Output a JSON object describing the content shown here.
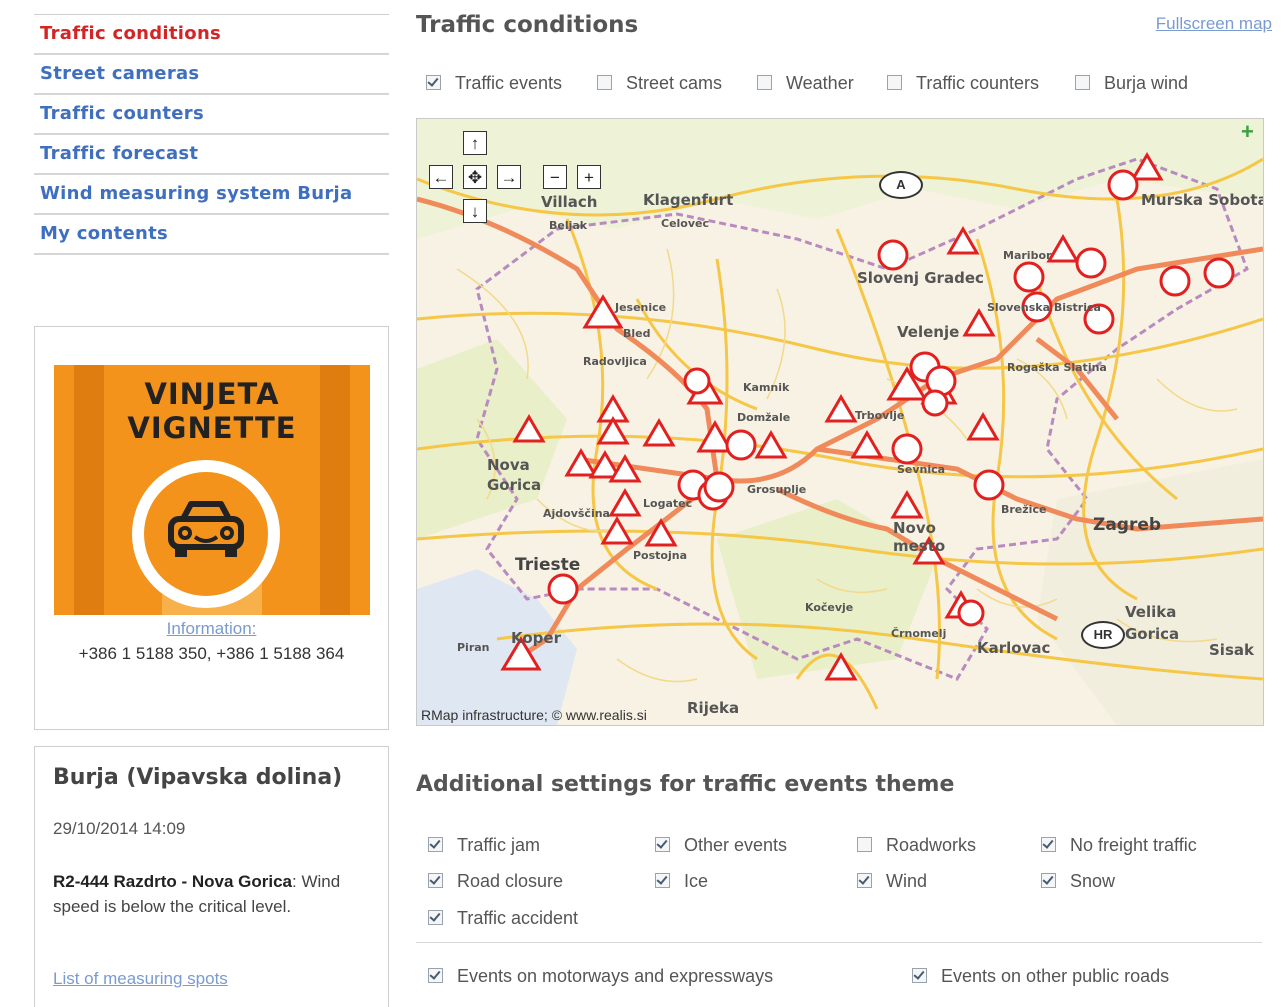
{
  "nav": {
    "items": [
      {
        "label": "Traffic conditions",
        "active": true
      },
      {
        "label": "Street cameras"
      },
      {
        "label": "Traffic counters"
      },
      {
        "label": "Traffic forecast"
      },
      {
        "label": "Wind measuring system Burja"
      },
      {
        "label": "My contents"
      }
    ]
  },
  "vignette": {
    "title_line1": "VINJETA",
    "title_line2": "VIGNETTE",
    "info_link": "Information:",
    "phones": "+386 1 5188 350, +386 1 5188 364"
  },
  "burja": {
    "title": "Burja (Vipavska dolina)",
    "date": "29/10/2014 14:09",
    "road": "R2-444 Razdrto - Nova Gorica",
    "message": ": Wind speed is below the critical level.",
    "link": "List of measuring spots"
  },
  "main": {
    "title": "Traffic conditions",
    "fullscreen_link": "Fullscreen map",
    "layers": [
      {
        "label": "Traffic events",
        "checked": true
      },
      {
        "label": "Street cams",
        "checked": false
      },
      {
        "label": "Weather",
        "checked": false
      },
      {
        "label": "Traffic counters",
        "checked": false
      },
      {
        "label": "Burja wind",
        "checked": false
      }
    ]
  },
  "map": {
    "copyright": "RMap infrastructure; © www.realis.si",
    "cities": [
      "Villach",
      "Beljak",
      "Klagenfurt",
      "Celovec",
      "Slovenj Gradec",
      "Maribor",
      "Murska Sobota",
      "Slovenska Bistrica",
      "Velenje",
      "Rogaška Slatina",
      "Kamnik",
      "Domžale",
      "Trbovlje",
      "Bled",
      "Radovljica",
      "Jesenice",
      "Nova Gorica",
      "Ajdovščina",
      "Logatec",
      "Grosuplje",
      "Sevnica",
      "Brežice",
      "Zagreb",
      "Novo mesto",
      "Trieste",
      "Koper",
      "Piran",
      "Postojna",
      "Kočevje",
      "Črnomelj",
      "Karlovac",
      "Velika Gorica",
      "Sisak",
      "Rijeka"
    ],
    "country_badges": [
      "A",
      "HR"
    ],
    "colors": {
      "motorway": "#f08a5a",
      "main_road": "#f6c646",
      "land": "#f7f2e3",
      "forest": "#e8efc9",
      "border": "#b88ac0",
      "event_red": "#e32020"
    }
  },
  "additional": {
    "title": "Additional settings for traffic events theme",
    "options": [
      {
        "label": "Traffic jam",
        "checked": true
      },
      {
        "label": "Other events",
        "checked": true
      },
      {
        "label": "Roadworks",
        "checked": false
      },
      {
        "label": "No freight traffic",
        "checked": true
      },
      {
        "label": "Road closure",
        "checked": true
      },
      {
        "label": "Ice",
        "checked": true
      },
      {
        "label": "Wind",
        "checked": true
      },
      {
        "label": "Snow",
        "checked": true
      },
      {
        "label": "Traffic accident",
        "checked": true
      }
    ],
    "roads": [
      {
        "label": "Events on motorways and expressways",
        "checked": true
      },
      {
        "label": "Events on other public roads",
        "checked": true
      }
    ]
  }
}
